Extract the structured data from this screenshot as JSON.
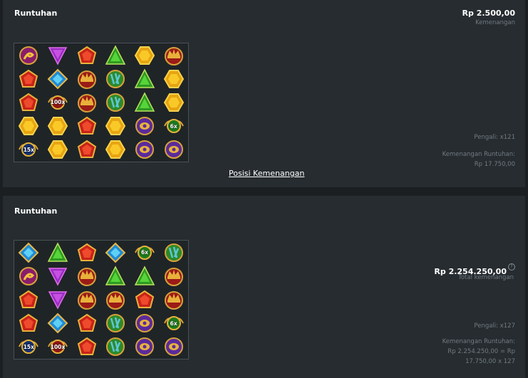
{
  "panel1": {
    "title": "Runtuhan",
    "bet_amount": "Rp 2.500,00",
    "bet_label": "Kemenangan",
    "multiplier_text": "Pengali: x121",
    "cascade_label": "Kemenangan Runtuhan:",
    "cascade_value": "Rp 17.750,00",
    "link_label": "Posisi Kemenangan",
    "grid": [
      [
        "snake",
        "amethyst",
        "ruby-pent",
        "emerald-tri",
        "citrine-hex",
        "crown"
      ],
      [
        "ruby-pent",
        "sapphire",
        "crown",
        "scarab-green",
        "emerald-tri",
        "citrine-hex"
      ],
      [
        "ruby-pent",
        "mult-100x",
        "crown",
        "scarab-green",
        "emerald-tri",
        "citrine-hex"
      ],
      [
        "citrine-hex",
        "citrine-hex",
        "ruby-pent",
        "citrine-hex",
        "scarab-purple",
        "mult-6x"
      ],
      [
        "mult-15x",
        "citrine-hex",
        "ruby-pent",
        "citrine-hex",
        "scarab-purple",
        "scarab-purple"
      ]
    ]
  },
  "panel2": {
    "title": "Runtuhan",
    "total_amount": "Rp 2.254.250,00",
    "total_label": "Total kemenangan",
    "help_glyph": "?",
    "multiplier_text": "Pengali: x127",
    "cascade_label": "Kemenangan Runtuhan:",
    "cascade_line1": "Rp 2.254.250,00 = Rp",
    "cascade_line2": "17.750,00 x 127",
    "grid": [
      [
        "sapphire",
        "emerald-tri",
        "ruby-pent",
        "sapphire",
        "mult-6x",
        "scarab-green"
      ],
      [
        "snake",
        "amethyst",
        "crown",
        "emerald-tri",
        "emerald-tri",
        "crown"
      ],
      [
        "ruby-pent",
        "amethyst",
        "crown",
        "crown",
        "ruby-pent",
        "crown"
      ],
      [
        "ruby-pent",
        "sapphire",
        "ruby-pent",
        "scarab-green",
        "scarab-purple",
        "mult-6x"
      ],
      [
        "mult-15x",
        "mult-100x",
        "ruby-pent",
        "scarab-green",
        "scarab-purple",
        "scarab-purple"
      ]
    ]
  },
  "symbol_labels": {
    "mult-100x": "100x",
    "mult-6x": "6x",
    "mult-15x": "15x"
  }
}
